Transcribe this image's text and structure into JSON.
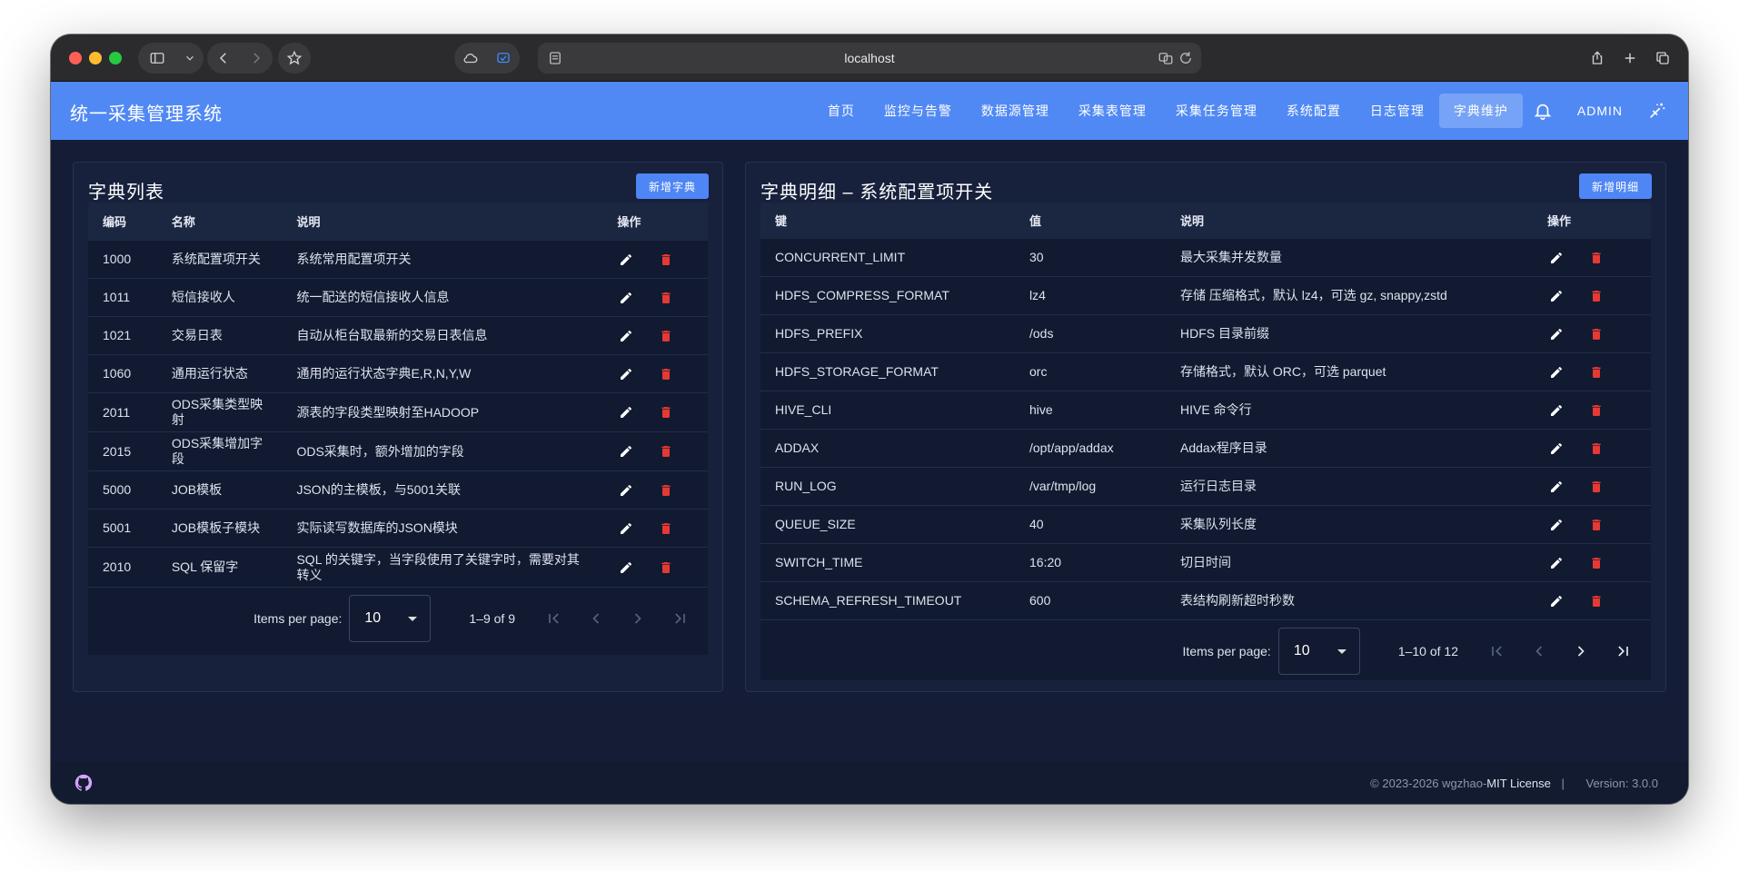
{
  "browser": {
    "url": "localhost"
  },
  "app": {
    "title": "统一采集管理系统",
    "nav": [
      "首页",
      "监控与告警",
      "数据源管理",
      "采集表管理",
      "采集任务管理",
      "系统配置",
      "日志管理",
      "字典维护"
    ],
    "active_nav": "字典维护",
    "user": "ADMIN"
  },
  "dict_list": {
    "title": "字典列表",
    "add_label": "新增字典",
    "columns": [
      "编码",
      "名称",
      "说明",
      "操作"
    ],
    "rows": [
      {
        "code": "1000",
        "name": "系统配置项开关",
        "desc": "系统常用配置项开关"
      },
      {
        "code": "1011",
        "name": "短信接收人",
        "desc": "统一配送的短信接收人信息"
      },
      {
        "code": "1021",
        "name": "交易日表",
        "desc": "自动从柜台取最新的交易日表信息"
      },
      {
        "code": "1060",
        "name": "通用运行状态",
        "desc": "通用的运行状态字典E,R,N,Y,W"
      },
      {
        "code": "2011",
        "name": "ODS采集类型映射",
        "desc": "源表的字段类型映射至HADOOP"
      },
      {
        "code": "2015",
        "name": "ODS采集增加字段",
        "desc": "ODS采集时，额外增加的字段"
      },
      {
        "code": "5000",
        "name": "JOB模板",
        "desc": "JSON的主模板，与5001关联"
      },
      {
        "code": "5001",
        "name": "JOB模板子模块",
        "desc": "实际读写数据库的JSON模块"
      },
      {
        "code": "2010",
        "name": "SQL 保留字",
        "desc": "SQL 的关键字，当字段使用了关键字时，需要对其转义"
      }
    ],
    "pagination": {
      "label": "Items per page:",
      "per_page": "10",
      "range": "1–9 of 9"
    }
  },
  "dict_detail": {
    "title": "字典明细 – 系统配置项开关",
    "add_label": "新增明细",
    "columns": [
      "键",
      "值",
      "说明",
      "操作"
    ],
    "rows": [
      {
        "key": "CONCURRENT_LIMIT",
        "value": "30",
        "desc": "最大采集并发数量"
      },
      {
        "key": "HDFS_COMPRESS_FORMAT",
        "value": "lz4",
        "desc": "存储 压缩格式，默认 lz4，可选 gz, snappy,zstd"
      },
      {
        "key": "HDFS_PREFIX",
        "value": "/ods",
        "desc": "HDFS 目录前缀"
      },
      {
        "key": "HDFS_STORAGE_FORMAT",
        "value": "orc",
        "desc": "存储格式，默认 ORC，可选 parquet"
      },
      {
        "key": "HIVE_CLI",
        "value": "hive",
        "desc": "HIVE 命令行"
      },
      {
        "key": "ADDAX",
        "value": "/opt/app/addax",
        "desc": "Addax程序目录"
      },
      {
        "key": "RUN_LOG",
        "value": "/var/tmp/log",
        "desc": "运行日志目录"
      },
      {
        "key": "QUEUE_SIZE",
        "value": "40",
        "desc": "采集队列长度"
      },
      {
        "key": "SWITCH_TIME",
        "value": "16:20",
        "desc": "切日时间"
      },
      {
        "key": "SCHEMA_REFRESH_TIMEOUT",
        "value": "600",
        "desc": "表结构刷新超时秒数"
      }
    ],
    "pagination": {
      "label": "Items per page:",
      "per_page": "10",
      "range": "1–10 of 12"
    }
  },
  "footer": {
    "copyright": "© 2023-2026 wgzhao-",
    "license": "MIT License",
    "separator": "|",
    "version": "Version: 3.0.0"
  },
  "colors": {
    "appbar": "#5189f4",
    "primary_button": "#4f86f5",
    "delete_icon": "#e53935",
    "background": "#141d35"
  }
}
